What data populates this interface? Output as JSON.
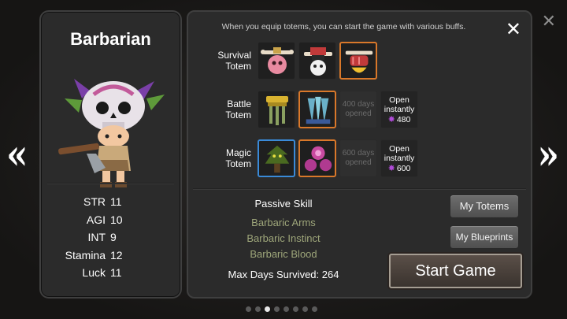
{
  "character": {
    "name": "Barbarian",
    "stats": [
      {
        "name": "STR",
        "value": "11"
      },
      {
        "name": "AGI",
        "value": "10"
      },
      {
        "name": "INT",
        "value": "9"
      },
      {
        "name": "Stamina",
        "value": "12"
      },
      {
        "name": "Luck",
        "value": "11"
      }
    ]
  },
  "totems": {
    "hint": "When you equip totems, you can start the game with various buffs.",
    "rows": [
      {
        "label_line1": "Survival",
        "label_line2": "Totem"
      },
      {
        "label_line1": "Battle",
        "label_line2": "Totem",
        "locked_line1": "400 days",
        "locked_line2": "opened",
        "open_line1": "Open",
        "open_line2": "instantly",
        "price": "480"
      },
      {
        "label_line1": "Magic",
        "label_line2": "Totem",
        "locked_line1": "600 days",
        "locked_line2": "opened",
        "open_line1": "Open",
        "open_line2": "instantly",
        "price": "600"
      }
    ]
  },
  "passive": {
    "title": "Passive Skill",
    "skills": [
      "Barbaric Arms",
      "Barbaric Instinct",
      "Barbaric Blood"
    ]
  },
  "max_days": "Max Days Survived: 264",
  "buttons": {
    "my_totems": "My Totems",
    "my_blueprints": "My Blueprints",
    "start_game": "Start Game"
  },
  "pagination": {
    "total": 8,
    "active": 3
  },
  "colors": {
    "selected_border": "#d9782a",
    "blue_border": "#3a8ad8",
    "skill_text": "#9ea67a",
    "gem": "#b04bd8"
  }
}
